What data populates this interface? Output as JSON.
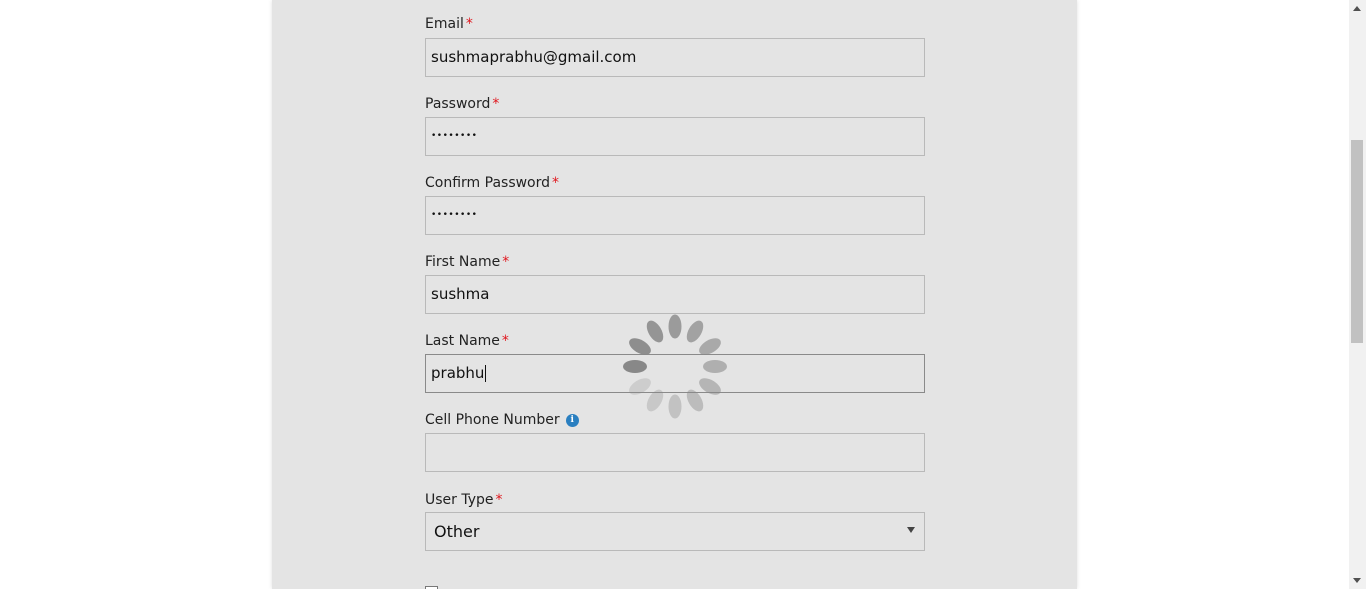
{
  "form": {
    "email": {
      "label": "Email",
      "required_mark": "*",
      "value": "sushmaprabhu@gmail.com"
    },
    "password": {
      "label": "Password",
      "required_mark": "*",
      "value": "••••••••"
    },
    "confirm_password": {
      "label": "Confirm Password",
      "required_mark": "*",
      "value": "••••••••"
    },
    "first_name": {
      "label": "First Name",
      "required_mark": "*",
      "value": "sushma"
    },
    "last_name": {
      "label": "Last Name",
      "required_mark": "*",
      "value": "prabhu"
    },
    "cell_phone": {
      "label": "Cell Phone Number",
      "info_icon": "i",
      "value": ""
    },
    "user_type": {
      "label": "User Type",
      "required_mark": "*",
      "selected": "Other"
    }
  },
  "colors": {
    "panel_bg": "#e4e4e4",
    "required": "#e0161d",
    "info_icon": "#2a7fc0",
    "spinner": "#888888"
  },
  "icons": {
    "loading": "loading-spinner-icon",
    "info": "info-icon",
    "dropdown": "chevron-down-icon"
  }
}
